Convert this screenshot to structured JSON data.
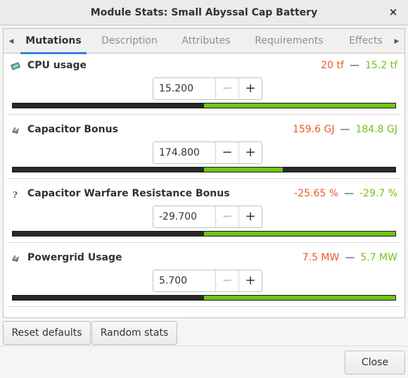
{
  "window": {
    "title": "Module Stats: Small Abyssal Cap Battery",
    "close_glyph": "×"
  },
  "tabs": [
    {
      "label": "Mutations",
      "active": true
    },
    {
      "label": "Description",
      "active": false
    },
    {
      "label": "Attributes",
      "active": false
    },
    {
      "label": "Requirements",
      "active": false
    },
    {
      "label": "Effects",
      "active": false
    }
  ],
  "tab_arrows": {
    "left": "◀",
    "right": "▶"
  },
  "mutations": [
    {
      "label": "CPU usage",
      "icon": "cpu-icon",
      "min": "20 tf",
      "dash": "—",
      "max": "15.2 tf",
      "value": "15.200",
      "minus": "−",
      "plus": "+",
      "fill_start": 0.5,
      "fill_end": 1.0
    },
    {
      "label": "Capacitor Bonus",
      "icon": "capacitor-icon",
      "min": "159.6 GJ",
      "dash": "—",
      "max": "184.8 GJ",
      "value": "174.800",
      "minus": "−",
      "plus": "+",
      "fill_start": 0.5,
      "fill_end": 0.705
    },
    {
      "label": "Capacitor Warfare Resistance Bonus",
      "icon": "question-icon",
      "min": "-25.65 %",
      "dash": "—",
      "max": "-29.7 %",
      "value": "-29.700",
      "minus": "−",
      "plus": "+",
      "fill_start": 0.5,
      "fill_end": 1.0
    },
    {
      "label": "Powergrid Usage",
      "icon": "powergrid-icon",
      "min": "7.5 MW",
      "dash": "—",
      "max": "5.7 MW",
      "value": "5.700",
      "minus": "−",
      "plus": "+",
      "fill_start": 0.5,
      "fill_end": 1.0
    }
  ],
  "buttons": {
    "reset": "Reset defaults",
    "random": "Random stats",
    "close": "Close"
  },
  "colors": {
    "min": "#e8592b",
    "max": "#73c214",
    "bar_fill": "#6fc416",
    "bar_bg": "#282828",
    "tab_accent": "#3584e4"
  }
}
